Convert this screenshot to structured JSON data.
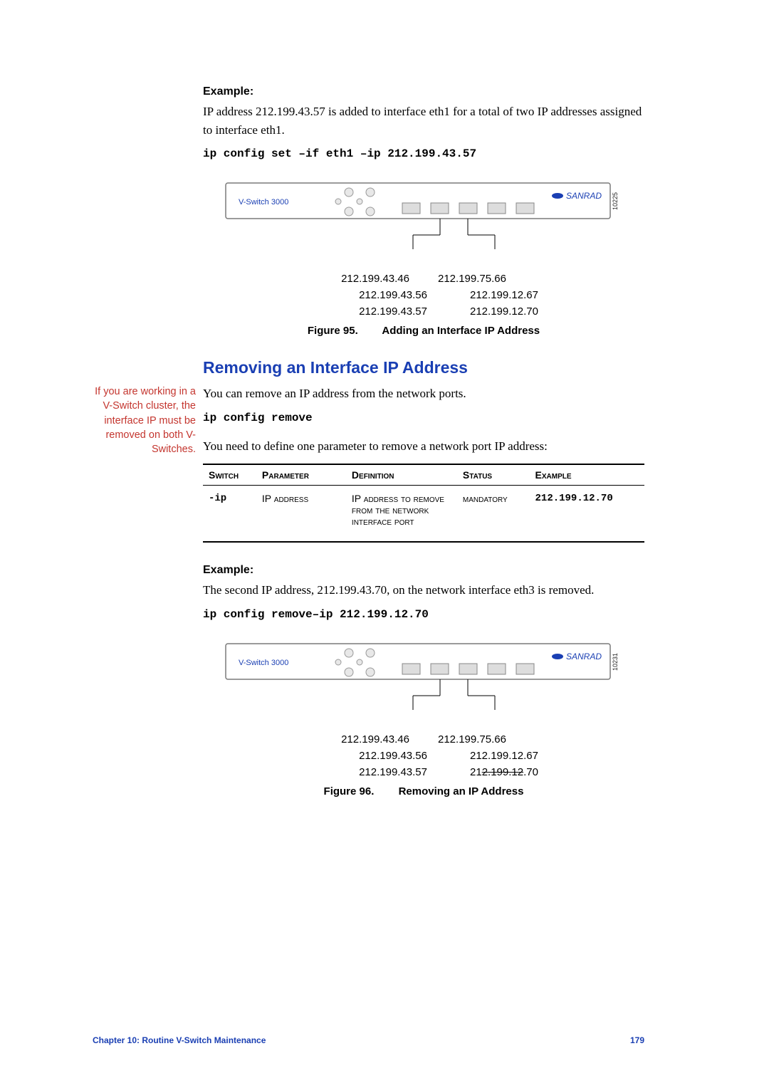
{
  "example1": {
    "heading": "Example:",
    "text": "IP address 212.199.43.57 is added to interface eth1 for a total of two IP addresses assigned to interface eth1.",
    "code": "ip config set –if eth1 –ip 212.199.43.57"
  },
  "figure95": {
    "device_label": "V-Switch 3000",
    "brand_label": "SANRAD",
    "side_code": "10225",
    "ips": {
      "r1a": "212.199.43.46",
      "r1b": "212.199.75.66",
      "r2a": "212.199.43.56",
      "r2b": "212.199.12.67",
      "r3a": "212.199.43.57",
      "r3b": "212.199.12.70"
    },
    "fignum": "Figure 95.",
    "title": "Adding an Interface IP Address"
  },
  "section": {
    "heading": "Removing an Interface IP Address",
    "sidebar": "If you are working in a V-Switch cluster, the interface IP must be removed on both V-Switches.",
    "para1": "You can remove an IP address from the network ports.",
    "code1": "ip config remove",
    "para2": "You need to define one parameter to remove a network port IP address:"
  },
  "table": {
    "headers": {
      "switch": "Switch",
      "param": "Parameter",
      "def": "Definition",
      "status": "Status",
      "example": "Example"
    },
    "row": {
      "switch": "-ip",
      "param": "IP address",
      "def": "IP address to remove from the network interface port",
      "status": "mandatory",
      "example": "212.199.12.70"
    }
  },
  "example2": {
    "heading": "Example:",
    "text": "The second IP address, 212.199.43.70, on the network interface eth3 is removed.",
    "code": "ip config remove–ip 212.199.12.70"
  },
  "figure96": {
    "device_label": "V-Switch 3000",
    "brand_label": "SANRAD",
    "side_code": "10231",
    "ips": {
      "r1a": "212.199.43.46",
      "r1b": "212.199.75.66",
      "r2a": "212.199.43.56",
      "r2b": "212.199.12.67",
      "r3a": "212.199.43.57",
      "r3b_prefix": "21",
      "r3b_struck": "2.199.12",
      "r3b_suffix": ".70"
    },
    "fignum": "Figure 96.",
    "title": "Removing an IP Address"
  },
  "footer": {
    "chapter": "Chapter 10:  Routine V-Switch Maintenance",
    "page": "179"
  }
}
